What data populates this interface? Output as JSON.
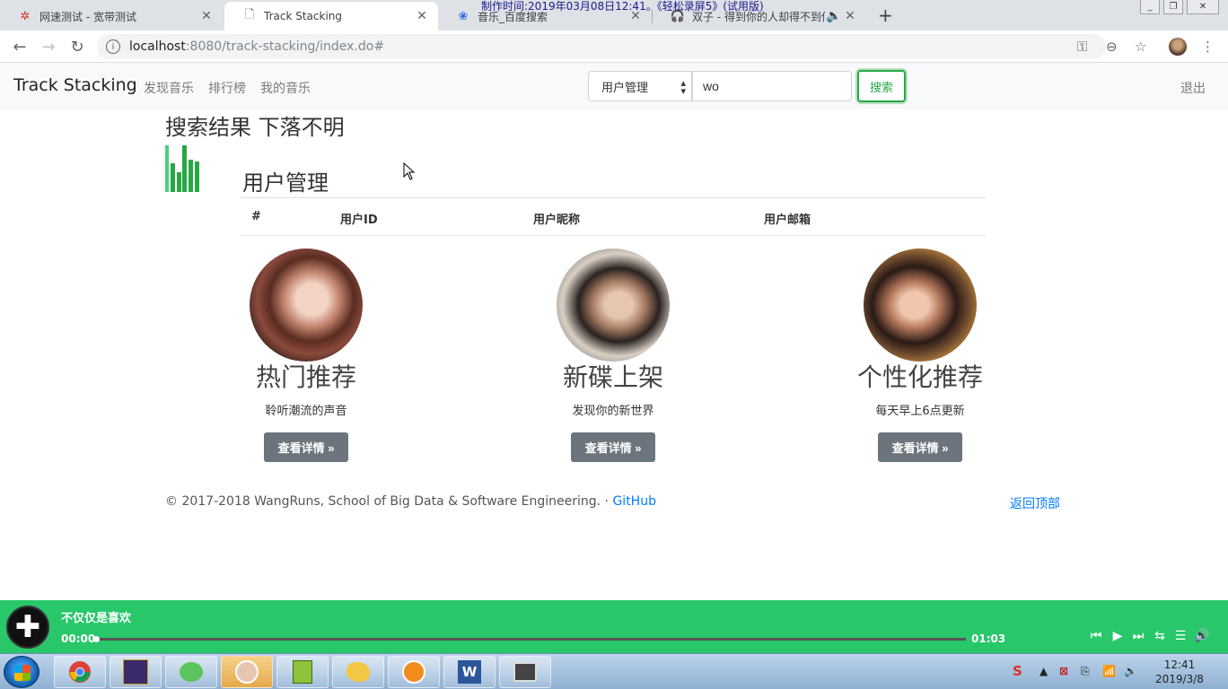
{
  "browser": {
    "tabs": [
      {
        "title": "网速测试 - 宽带测试",
        "icon": "speedtest-favicon"
      },
      {
        "title": "Track Stacking",
        "icon": "page-icon"
      },
      {
        "title": "音乐_百度搜索",
        "icon": "baidu-paw-icon"
      },
      {
        "title": "双子 - 得到你的人却得不到你",
        "icon": "music-favicon"
      }
    ],
    "url_host": "localhost",
    "url_path": ":8080/track-stacking/index.do#",
    "watermark": "制作时间:2019年03月08日12:41。《轻松录屏5》(试用版)"
  },
  "navbar": {
    "brand": "Track Stacking",
    "links": [
      "发现音乐",
      "排行榜",
      "我的音乐"
    ],
    "search_category": "用户管理",
    "search_value": "wo",
    "search_button": "搜索",
    "logout": "退出"
  },
  "main": {
    "search_title": "搜索结果 下落不明",
    "section_title": "用户管理",
    "table_headers": [
      "#",
      "用户ID",
      "用户昵称",
      "用户邮箱"
    ],
    "columns": [
      {
        "heading": "热门推荐",
        "desc": "聆听潮流的声音",
        "button": "查看详情 »"
      },
      {
        "heading": "新碟上架",
        "desc": "发现你的新世界",
        "button": "查看详情 »"
      },
      {
        "heading": "个性化推荐",
        "desc": "每天早上6点更新",
        "button": "查看详情 »"
      }
    ]
  },
  "footer": {
    "copyright": "© 2017-2018 WangRuns, School of Big Data & Software Engineering. · ",
    "github": "GitHub",
    "back_to_top": "返回顶部"
  },
  "player": {
    "song": "不仅仅是喜欢",
    "current_time": "00:00",
    "duration": "01:03",
    "progress": 0.0
  },
  "taskbar": {
    "clock_time": "12:41",
    "clock_date": "2019/3/8"
  },
  "colors": {
    "accent_green": "#28a745",
    "player_green": "#28c76a",
    "link_blue": "#007bff"
  }
}
